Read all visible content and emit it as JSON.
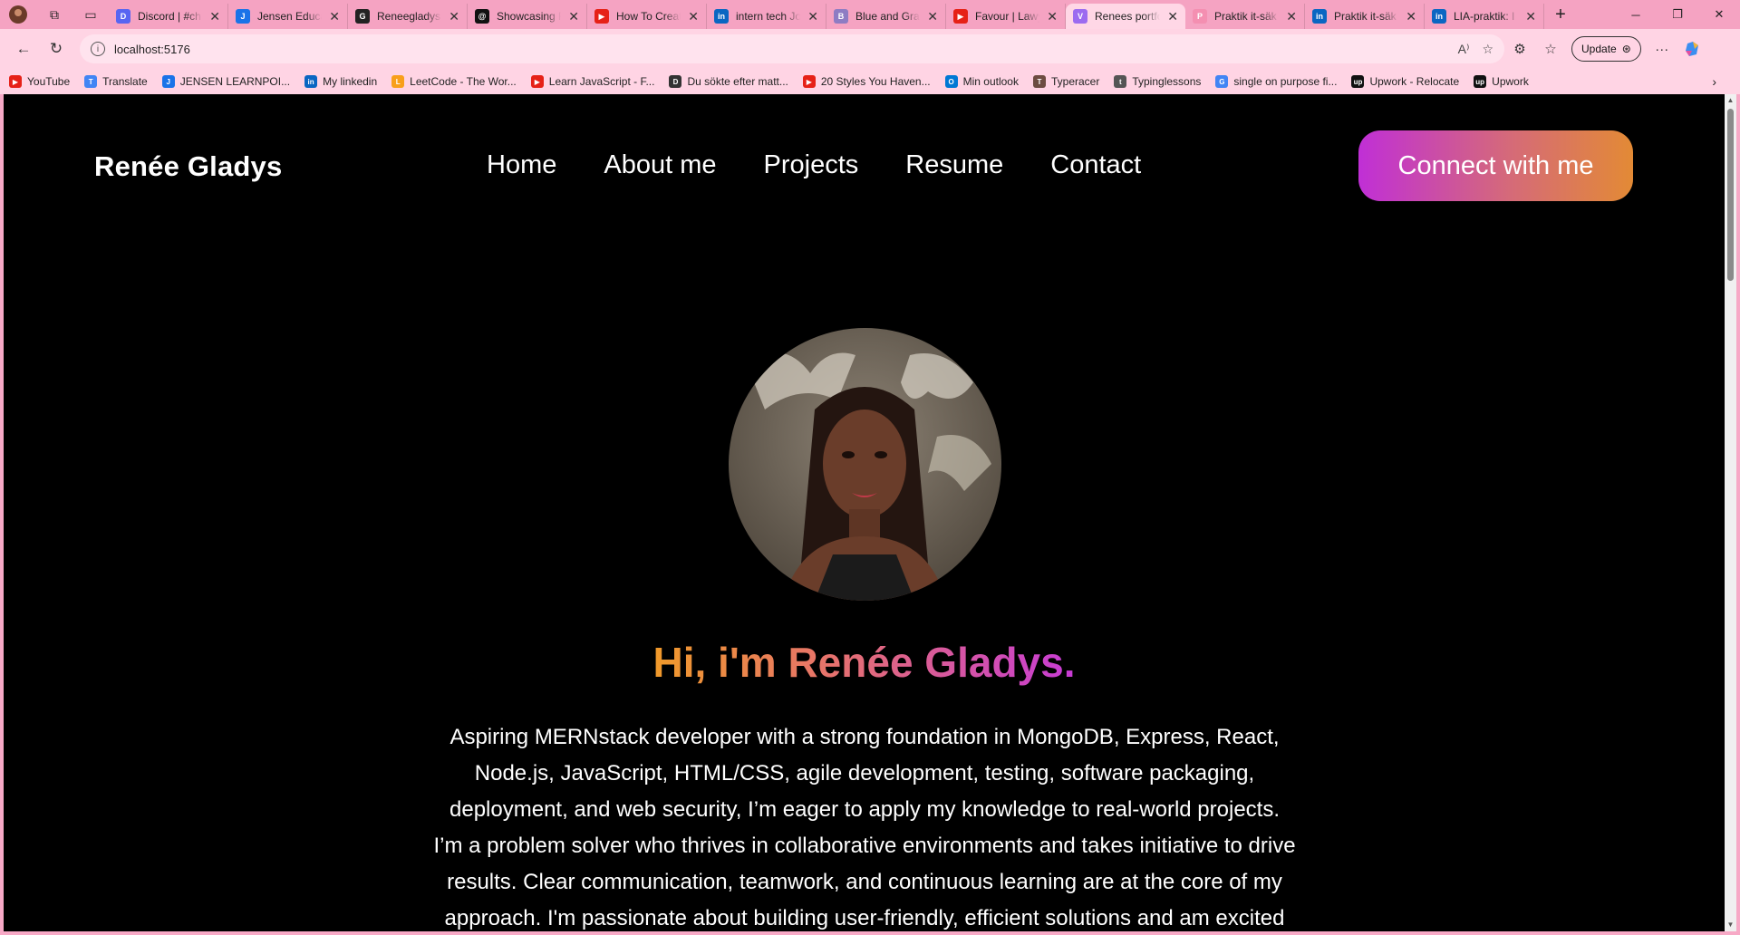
{
  "browser": {
    "tabs": [
      {
        "title": "Discord | #ch",
        "fav_color": "#5865f2",
        "fav_glyph": "D",
        "active": false
      },
      {
        "title": "Jensen Educa",
        "fav_color": "#1a73e8",
        "fav_glyph": "J",
        "active": false
      },
      {
        "title": "Reneegladys",
        "fav_color": "#222222",
        "fav_glyph": "G",
        "active": false
      },
      {
        "title": "Showcasing F",
        "fav_color": "#111111",
        "fav_glyph": "@",
        "active": false
      },
      {
        "title": "How To Creat",
        "fav_color": "#e62117",
        "fav_glyph": "▶",
        "active": false
      },
      {
        "title": "intern tech Jo",
        "fav_color": "#0a66c2",
        "fav_glyph": "in",
        "active": false
      },
      {
        "title": "Blue and Gray",
        "fav_color": "#8e7cc3",
        "fav_glyph": "B",
        "active": false
      },
      {
        "title": "Favour | Lawy",
        "fav_color": "#e62117",
        "fav_glyph": "▶",
        "active": false
      },
      {
        "title": "Renees portfo",
        "fav_color": "#9c6bf0",
        "fav_glyph": "V",
        "active": true
      },
      {
        "title": "Praktik it-säk",
        "fav_color": "#f48fb1",
        "fav_glyph": "P",
        "active": false
      },
      {
        "title": "Praktik it-säk",
        "fav_color": "#0a66c2",
        "fav_glyph": "in",
        "active": false
      },
      {
        "title": "LIA-praktik: I",
        "fav_color": "#0a66c2",
        "fav_glyph": "in",
        "active": false
      }
    ],
    "url": "localhost:5176",
    "update_label": "Update",
    "bookmarks": [
      {
        "label": "YouTube",
        "color": "#e62117",
        "glyph": "▶"
      },
      {
        "label": "Translate",
        "color": "#4285f4",
        "glyph": "T"
      },
      {
        "label": "JENSEN LEARNPOI...",
        "color": "#1a73e8",
        "glyph": "J"
      },
      {
        "label": "My linkedin",
        "color": "#0a66c2",
        "glyph": "in"
      },
      {
        "label": "LeetCode - The Wor...",
        "color": "#f89f1b",
        "glyph": "L"
      },
      {
        "label": "Learn JavaScript - F...",
        "color": "#e62117",
        "glyph": "▶"
      },
      {
        "label": "Du sökte efter matt...",
        "color": "#333333",
        "glyph": "D"
      },
      {
        "label": "20 Styles You Haven...",
        "color": "#e62117",
        "glyph": "▶"
      },
      {
        "label": "Min outlook",
        "color": "#0078d4",
        "glyph": "O"
      },
      {
        "label": "Typeracer",
        "color": "#6d4c41",
        "glyph": "T"
      },
      {
        "label": "Typinglessons",
        "color": "#555555",
        "glyph": "t"
      },
      {
        "label": "single on purpose fi...",
        "color": "#4285f4",
        "glyph": "G"
      },
      {
        "label": "Upwork - Relocate",
        "color": "#111111",
        "glyph": "up"
      },
      {
        "label": "Upwork",
        "color": "#111111",
        "glyph": "up"
      }
    ]
  },
  "site": {
    "logo": "Renée Gladys",
    "nav": [
      "Home",
      "About me",
      "Projects",
      "Resume",
      "Contact"
    ],
    "cta": "Connect with me",
    "hero_title": "Hi, i'm Renée Gladys.",
    "bio_lines": [
      "Aspiring MERNstack developer with a strong foundation in MongoDB, Express, React,",
      "Node.js, JavaScript, HTML/CSS, agile development, testing, software packaging,",
      "deployment, and web security, I’m eager to apply my knowledge to real-world projects.",
      "I’m a problem solver who thrives in collaborative environments and takes initiative to drive",
      "results. Clear communication, teamwork, and continuous learning are at the core of my",
      "approach. I'm passionate about building user-friendly, efficient solutions and am excited"
    ]
  },
  "colors": {
    "gradient_start": "#c02fd6",
    "gradient_mid": "#d56a79",
    "gradient_end": "#e38a35",
    "page_bg": "#000000"
  }
}
